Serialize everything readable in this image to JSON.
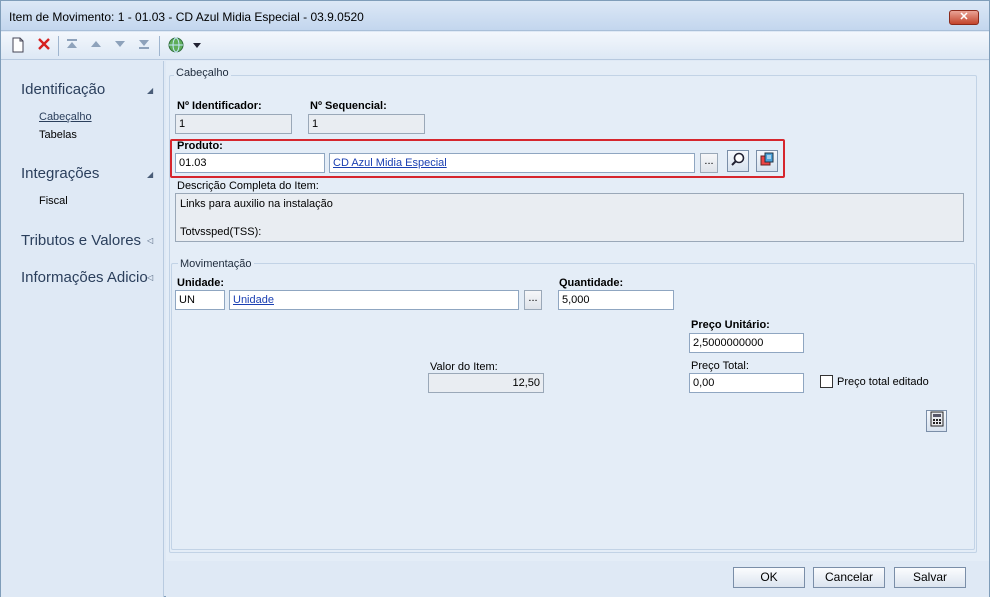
{
  "window": {
    "title": "Item de Movimento: 1 - 01.03 - CD Azul Midia Especial - 03.9.0520",
    "close_glyph": "✕"
  },
  "toolbar": {
    "icons": [
      "new-icon",
      "delete-icon",
      "first-icon",
      "previous-icon",
      "next-icon",
      "last-icon",
      "globe-icon",
      "dropdown-arrow-icon"
    ]
  },
  "nav": {
    "sections": [
      {
        "label": "Identificação",
        "items": [
          "Cabeçalho",
          "Tabelas"
        ]
      },
      {
        "label": "Integrações",
        "items": [
          "Fiscal"
        ]
      },
      {
        "label": "Tributos e Valores",
        "items": []
      },
      {
        "label": "Informações Adicio",
        "items": []
      }
    ]
  },
  "cabecalho": {
    "group_label": "Cabeçalho",
    "identificador": {
      "label": "Nº Identificador:",
      "value": "1"
    },
    "sequencial": {
      "label": "Nº Sequencial:",
      "value": "1"
    },
    "produto": {
      "label": "Produto:",
      "code": "01.03",
      "name": "CD Azul Midia Especial",
      "ellipsis": "..."
    },
    "descricao": {
      "label": "Descrição Completa do Item:",
      "lines": [
        "Links para auxilio na instalação",
        "",
        "Totvssped(TSS):"
      ]
    }
  },
  "movimentacao": {
    "group_label": "Movimentação",
    "unidade": {
      "label": "Unidade:",
      "code": "UN",
      "name": "Unidade",
      "ellipsis": "..."
    },
    "quantidade": {
      "label": "Quantidade:",
      "value": "5,000"
    },
    "preco_unitario": {
      "label": "Preço Unitário:",
      "value": "2,5000000000"
    },
    "valor_item": {
      "label": "Valor do Item:",
      "value": "12,50"
    },
    "preco_total": {
      "label": "Preço Total:",
      "value": "0,00"
    },
    "preco_total_editado": {
      "label": "Preço total editado",
      "checked": false
    }
  },
  "buttons": {
    "ok": "OK",
    "cancel": "Cancelar",
    "save": "Salvar"
  },
  "colors": {
    "highlight": "#d6262d",
    "link": "#1a3fb2",
    "nav_text": "#2b3f5c"
  }
}
